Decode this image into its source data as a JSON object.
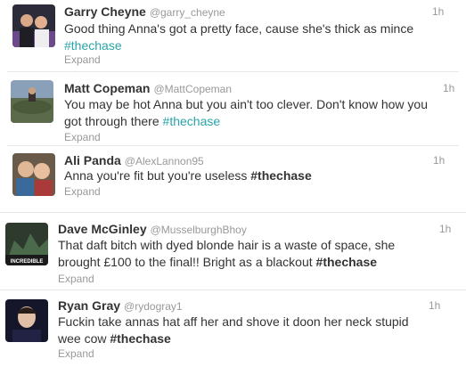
{
  "tweets": [
    {
      "name": "Garry Cheyne",
      "handle": "@garry_cheyne",
      "time": "1h",
      "text": "Good thing Anna's got a pretty face, cause she's thick as mince ",
      "hashtag": "#thechase",
      "expand": "Expand"
    },
    {
      "name": "Matt Copeman",
      "handle": "@MattCopeman",
      "time": "1h",
      "text": "You may be hot Anna but you ain't too clever. Don't know how you got through there ",
      "hashtag": "#thechase",
      "expand": "Expand"
    },
    {
      "name": "Ali Panda",
      "handle": "@AlexLannon95",
      "time": "1h",
      "text": "Anna you're fit but you're useless ",
      "hashtag": "#thechase",
      "expand": "Expand"
    },
    {
      "name": "Dave McGinley",
      "handle": "@MusselburghBhoy",
      "time": "1h",
      "text": "That daft bitch with dyed blonde hair is a waste of space, she brought £100 to the final!! Bright as a blackout  ",
      "hashtag": "#thechase",
      "expand": "Expand",
      "avatar_label": "INCREDIBLE"
    },
    {
      "name": "Ryan Gray",
      "handle": "@rydogray1",
      "time": "1h",
      "text": "Fuckin take annas hat aff her and shove it doon her neck stupid wee cow ",
      "hashtag": "#thechase",
      "expand": "Expand"
    }
  ],
  "colors": {
    "hashtag_link": "#2aa4a8",
    "muted": "#999999",
    "text": "#333333"
  }
}
